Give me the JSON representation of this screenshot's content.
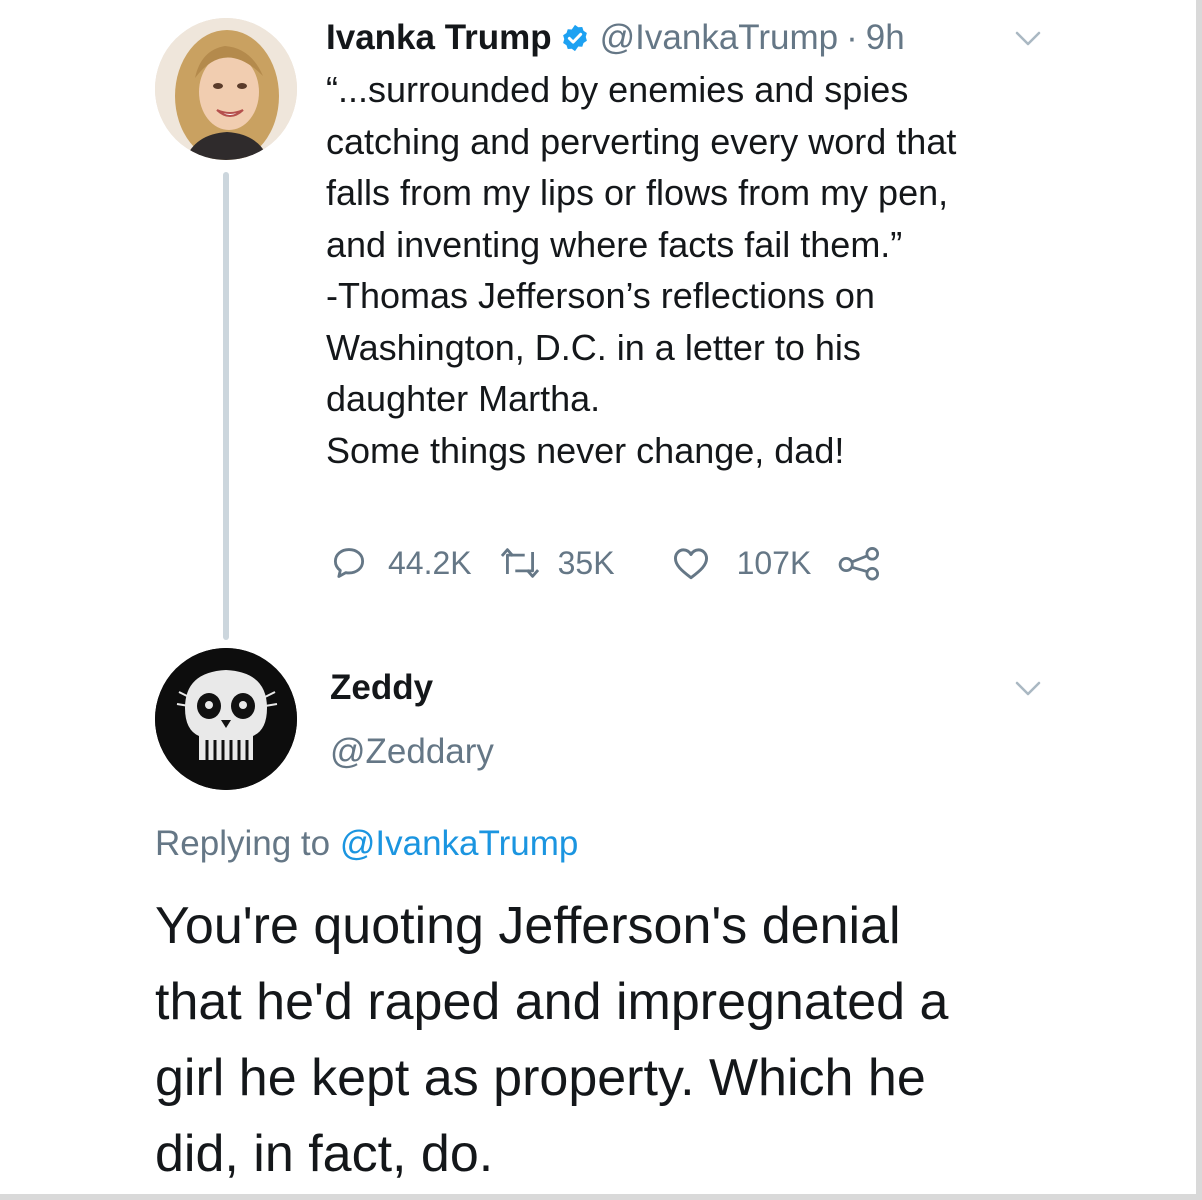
{
  "tweet": {
    "author_name": "Ivanka Trump",
    "handle": "@IvankaTrump",
    "separator": "·",
    "time": "9h",
    "text_lines": [
      "“...surrounded by enemies and spies",
      "catching and perverting every word that",
      "falls from my lips or flows from my pen,",
      "and inventing where facts fail them.”",
      "-Thomas Jefferson’s reflections on",
      "Washington, D.C. in a letter to his",
      "daughter Martha.",
      "Some things never change, dad!"
    ],
    "replies": "44.2K",
    "retweets": "35K",
    "likes": "107K"
  },
  "reply": {
    "author_name": "Zeddy",
    "handle": "@Zeddary",
    "replying_prefix": "Replying to",
    "replying_to": "@IvankaTrump",
    "text_lines": [
      "You're quoting Jefferson's denial",
      "that he'd raped and impregnated a",
      "girl he kept as property. Which he",
      "did, in fact, do."
    ]
  },
  "colors": {
    "text": "#14171a",
    "secondary": "#657786",
    "link": "#1b95e0",
    "verified": "#1da1f2",
    "thread_line": "#ccd6dd"
  },
  "icons": [
    "verified-badge-icon",
    "chevron-down-icon",
    "reply-icon",
    "retweet-icon",
    "like-icon",
    "share-icon"
  ]
}
